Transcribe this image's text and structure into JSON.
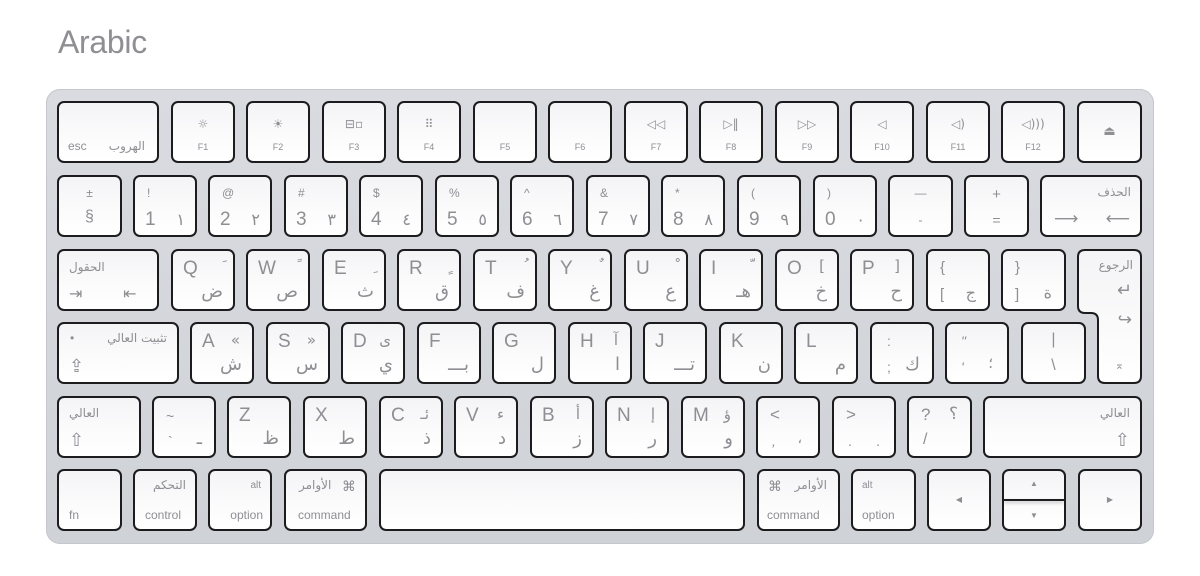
{
  "title": "Arabic",
  "function_row": {
    "esc": {
      "en": "esc",
      "ar": "الهروب"
    },
    "fkeys": [
      {
        "label": "F1",
        "icon": "brightness-down-icon",
        "glyph": "☼"
      },
      {
        "label": "F2",
        "icon": "brightness-up-icon",
        "glyph": "☀"
      },
      {
        "label": "F3",
        "icon": "mission-control-icon",
        "glyph": "⊟▫"
      },
      {
        "label": "F4",
        "icon": "launchpad-icon",
        "glyph": "⠿"
      },
      {
        "label": "F5",
        "icon": "",
        "glyph": ""
      },
      {
        "label": "F6",
        "icon": "",
        "glyph": ""
      },
      {
        "label": "F7",
        "icon": "rewind-icon",
        "glyph": "◁◁"
      },
      {
        "label": "F8",
        "icon": "play-pause-icon",
        "glyph": "▷‖"
      },
      {
        "label": "F9",
        "icon": "fast-forward-icon",
        "glyph": "▷▷"
      },
      {
        "label": "F10",
        "icon": "mute-icon",
        "glyph": "◁"
      },
      {
        "label": "F11",
        "icon": "volume-down-icon",
        "glyph": "◁)"
      },
      {
        "label": "F12",
        "icon": "volume-up-icon",
        "glyph": "◁)))"
      }
    ],
    "eject": {
      "icon": "eject-icon",
      "glyph": "⏏"
    }
  },
  "number_row": {
    "section": {
      "shift": "±",
      "base": "§"
    },
    "keys": [
      {
        "shift": "!",
        "base": "1",
        "ar": "١"
      },
      {
        "shift": "@",
        "base": "2",
        "ar": "٢"
      },
      {
        "shift": "#",
        "base": "3",
        "ar": "٣"
      },
      {
        "shift": "$",
        "base": "4",
        "ar": "٤"
      },
      {
        "shift": "%",
        "base": "5",
        "ar": "٥"
      },
      {
        "shift": "^",
        "base": "6",
        "ar": "٦"
      },
      {
        "shift": "&",
        "base": "7",
        "ar": "٧"
      },
      {
        "shift": "*",
        "base": "8",
        "ar": "٨"
      },
      {
        "shift": "(",
        "base": "9",
        "ar": "٩"
      },
      {
        "shift": ")",
        "base": "0",
        "ar": "٠"
      }
    ],
    "minus": {
      "shift": "—",
      "base": "-"
    },
    "equal": {
      "shift": "+",
      "base": "="
    },
    "delete": {
      "ar": "الحذف",
      "glyph_left": "⟶",
      "glyph_right": "⟵"
    }
  },
  "top_row": {
    "tab": {
      "ar": "الحقول",
      "glyph_left": "⇥",
      "glyph_right": "⇤"
    },
    "keys": [
      {
        "en": "Q",
        "ar_shift": "َ",
        "ar": "ض"
      },
      {
        "en": "W",
        "ar_shift": "ً",
        "ar": "ص"
      },
      {
        "en": "E",
        "ar_shift": "ِ",
        "ar": "ث"
      },
      {
        "en": "R",
        "ar_shift": "ٍ",
        "ar": "ق"
      },
      {
        "en": "T",
        "ar_shift": "ُ",
        "ar": "ف"
      },
      {
        "en": "Y",
        "ar_shift": "ٌ",
        "ar": "غ"
      },
      {
        "en": "U",
        "ar_shift": "ْ",
        "ar": "ع"
      },
      {
        "en": "I",
        "ar_shift": "ّ",
        "ar": "هـ"
      },
      {
        "en": "O",
        "ar_shift": "[",
        "ar": "خ"
      },
      {
        "en": "P",
        "ar_shift": "]",
        "ar": "ح"
      }
    ],
    "bracket_left": {
      "shift": "{",
      "base": "[",
      "ar": "ج"
    },
    "bracket_right": {
      "shift": "}",
      "base": "]",
      "ar": "ة"
    },
    "return": {
      "ar": "الرجوع",
      "glyph1": "↵",
      "glyph2": "↪",
      "glyph3": "⌅"
    }
  },
  "home_row": {
    "caps": {
      "ar": "تثبيت العالي",
      "glyph": "⇪",
      "dot": "•"
    },
    "keys": [
      {
        "en": "A",
        "ar_shift": "«",
        "ar": "ش"
      },
      {
        "en": "S",
        "ar_shift": "»",
        "ar": "س"
      },
      {
        "en": "D",
        "ar_shift": "ى",
        "ar": "ي"
      },
      {
        "en": "F",
        "ar_shift": "",
        "ar": "بـــ"
      },
      {
        "en": "G",
        "ar_shift": "",
        "ar": "ل"
      },
      {
        "en": "H",
        "ar_shift": "آ",
        "ar": "ا"
      },
      {
        "en": "J",
        "ar_shift": "",
        "ar": "تـــ"
      },
      {
        "en": "K",
        "ar_shift": "",
        "ar": "ن"
      },
      {
        "en": "L",
        "ar_shift": "",
        "ar": "م"
      }
    ],
    "semicolon": {
      "shift": ":",
      "base": ";",
      "ar": "ك"
    },
    "quote": {
      "shift": "\"",
      "base": "'",
      "ar": "؛"
    },
    "backslash": {
      "shift": "|",
      "base": "\\"
    }
  },
  "bottom_row": {
    "lshift": {
      "ar": "العالي",
      "glyph": "⇧"
    },
    "grave": {
      "shift": "~",
      "base": "`",
      "ar": "ـ"
    },
    "keys": [
      {
        "en": "Z",
        "ar_shift": "",
        "ar": "ظ"
      },
      {
        "en": "X",
        "ar_shift": "",
        "ar": "ط"
      },
      {
        "en": "C",
        "ar_shift": "ئـ",
        "ar": "ذ"
      },
      {
        "en": "V",
        "ar_shift": "ء",
        "ar": "د"
      },
      {
        "en": "B",
        "ar_shift": "أ",
        "ar": "ز"
      },
      {
        "en": "N",
        "ar_shift": "إ",
        "ar": "ر"
      },
      {
        "en": "M",
        "ar_shift": "ؤ",
        "ar": "و"
      }
    ],
    "comma": {
      "shift": "<",
      "base": ",",
      "ar": "،"
    },
    "period": {
      "shift": ">",
      "base": ".",
      "ar": "."
    },
    "slash": {
      "shift": "?",
      "base": "/",
      "ar": "؟"
    },
    "rshift": {
      "ar": "العالي",
      "glyph": "⇧"
    }
  },
  "modifier_row": {
    "fn": {
      "en": "fn"
    },
    "control": {
      "en": "control",
      "ar": "التحكم"
    },
    "option_left": {
      "en": "option",
      "alt": "alt"
    },
    "command_left": {
      "en": "command",
      "ar": "الأوامر",
      "glyph": "⌘"
    },
    "space": {
      "en": ""
    },
    "command_right": {
      "en": "command",
      "ar": "الأوامر",
      "glyph": "⌘"
    },
    "option_right": {
      "en": "option",
      "alt": "alt"
    },
    "arrows": {
      "left": "◀",
      "up": "▲",
      "down": "▼",
      "right": "▶"
    }
  }
}
